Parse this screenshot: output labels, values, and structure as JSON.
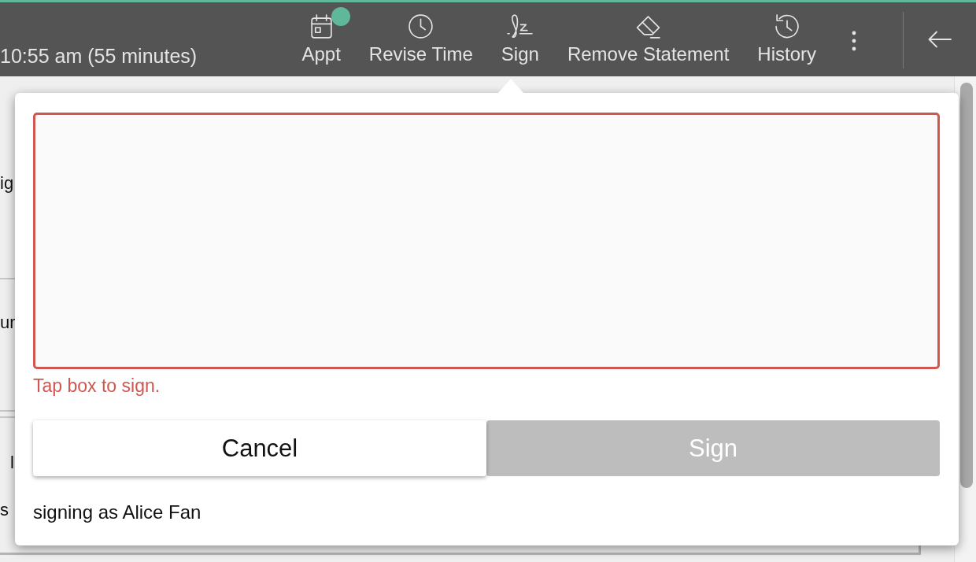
{
  "header": {
    "time_text": "10:55 am (55 minutes)",
    "actions": [
      {
        "kind": "calendar",
        "label": "Appt",
        "badge": true
      },
      {
        "kind": "clock",
        "label": "Revise Time",
        "badge": false
      },
      {
        "kind": "signature",
        "label": "Sign",
        "badge": false
      },
      {
        "kind": "eraser",
        "label": "Remove Statement",
        "badge": false
      },
      {
        "kind": "history",
        "label": "History",
        "badge": false
      }
    ]
  },
  "background": {
    "text_fragments": [
      "ig",
      "ur",
      "l",
      "s"
    ]
  },
  "sign_popover": {
    "signature_box": {
      "invalid": true,
      "error": "Tap box to sign."
    },
    "buttons": [
      {
        "label": "Cancel",
        "disabled": false
      },
      {
        "label": "Sign",
        "disabled": true
      }
    ],
    "signer_text": "signing as Alice Fan"
  }
}
